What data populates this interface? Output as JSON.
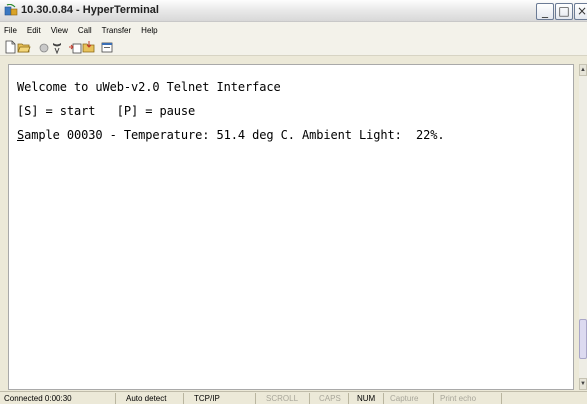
{
  "window": {
    "title": "10.30.0.84 - HyperTerminal",
    "app_icon": "hyperterminal-icon",
    "controls": {
      "minimize": "_",
      "maximize": "□",
      "close": "×"
    }
  },
  "menu": {
    "items": [
      "File",
      "Edit",
      "View",
      "Call",
      "Transfer",
      "Help"
    ]
  },
  "toolbar": {
    "icons": [
      "new-connection-icon",
      "open-icon",
      "disconnect-icon",
      "disconnect-phone-icon",
      "send-icon",
      "receive-icon",
      "properties-icon"
    ]
  },
  "terminal": {
    "lines": [
      "Welcome to uWeb-v2.0 Telnet Interface",
      "[S] = start   [P] = pause"
    ],
    "sample_line_first_char": "S",
    "sample_line_rest": "ample 00030 - Temperature: 51.4 deg C. Ambient Light:  22%."
  },
  "status": {
    "connected": "Connected 0:00:30",
    "detect": "Auto detect",
    "protocol": "TCP/IP",
    "scroll": "SCROLL",
    "caps": "CAPS",
    "num": "NUM",
    "capture": "Capture",
    "print_echo": "Print echo"
  }
}
